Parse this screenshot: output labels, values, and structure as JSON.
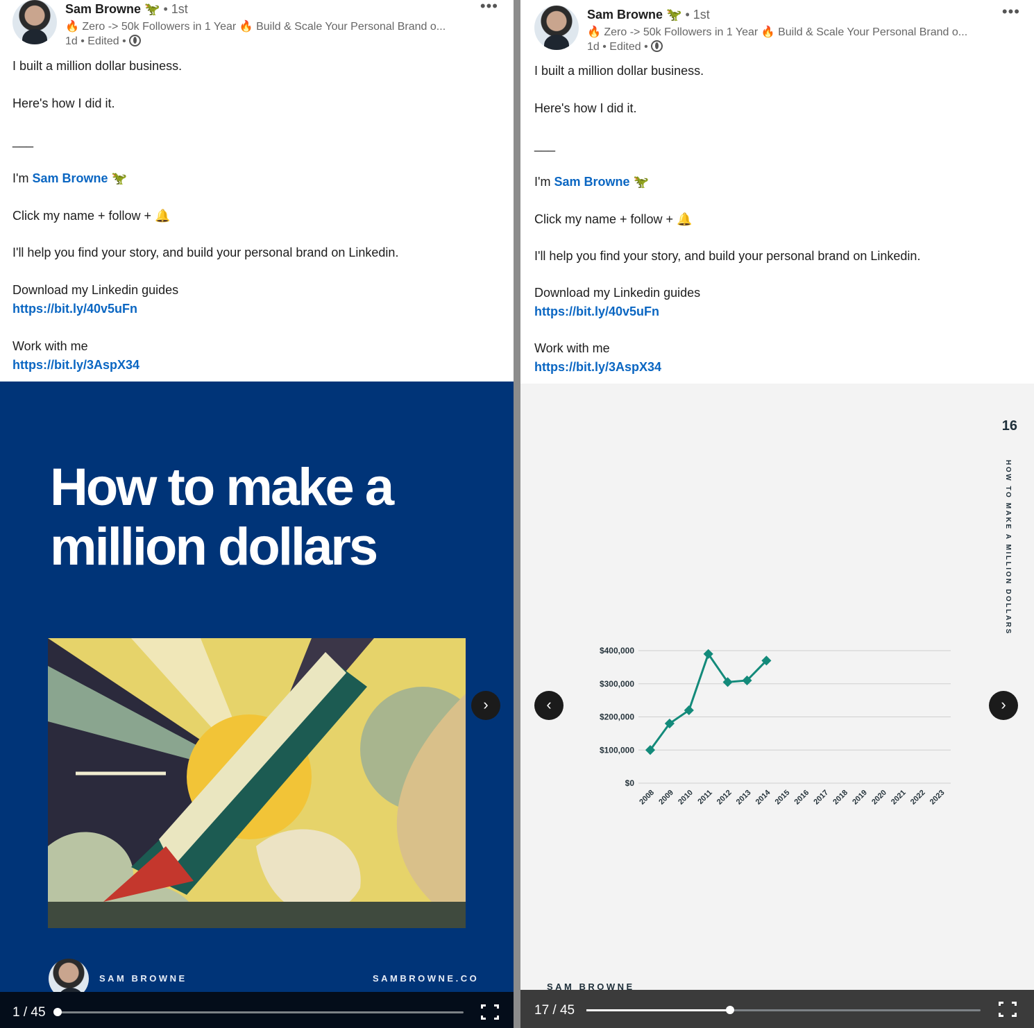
{
  "post": {
    "author": "Sam Browne",
    "author_emoji": "🦖",
    "degree": "• 1st",
    "tagline": "🔥 Zero -> 50k Followers in 1 Year 🔥 Build & Scale Your Personal Brand o...",
    "meta": "1d • Edited •",
    "more": "•••",
    "lines": {
      "l1": "I built a million dollar business.",
      "l2": "Here's how I did it.",
      "l3": "___",
      "l4a": "I'm ",
      "l4link": "Sam Browne",
      "l4b": " 🦖",
      "l5": "Click my name + follow + 🔔",
      "l6": "I'll help you find your story, and build your personal brand on Linkedin.",
      "l7": "Download my Linkedin guides",
      "link1": "https://bit.ly/40v5uFn",
      "l8": "Work with me",
      "link2": "https://bit.ly/3AspX34"
    }
  },
  "left_carousel": {
    "title_line1": "How to make a",
    "title_line2": "million dollars",
    "footer_name": "SAM BROWNE",
    "footer_site": "SAMBROWNE.CO",
    "counter": "1 / 45",
    "progress_fraction": 0.0,
    "next_icon": "›",
    "bg_color": "#003478"
  },
  "right_carousel": {
    "page_number": "16",
    "vertical_title": "HOW TO MAKE A MILLION DOLLARS",
    "footer_name": "SAM BROWNE",
    "counter": "17 / 45",
    "progress_fraction": 0.364,
    "prev_icon": "‹",
    "next_icon": "›"
  },
  "chart_data": {
    "type": "line",
    "categories": [
      "2008",
      "2009",
      "2010",
      "2011",
      "2012",
      "2013",
      "2014",
      "2015",
      "2016",
      "2017",
      "2018",
      "2019",
      "2020",
      "2021",
      "2022",
      "2023"
    ],
    "values": [
      100000,
      180000,
      220000,
      390000,
      305000,
      310000,
      370000,
      null,
      null,
      null,
      null,
      null,
      null,
      null,
      null,
      null
    ],
    "yticks": [
      0,
      100000,
      200000,
      300000,
      400000
    ],
    "ytick_labels": [
      "$0",
      "$100,000",
      "$200,000",
      "$300,000",
      "$400,000"
    ],
    "ylim": [
      0,
      400000
    ],
    "grid": true,
    "marker": "diamond",
    "color": "#138a7a"
  },
  "colors": {
    "link": "#0a66c2",
    "accent_teal": "#138a7a"
  }
}
